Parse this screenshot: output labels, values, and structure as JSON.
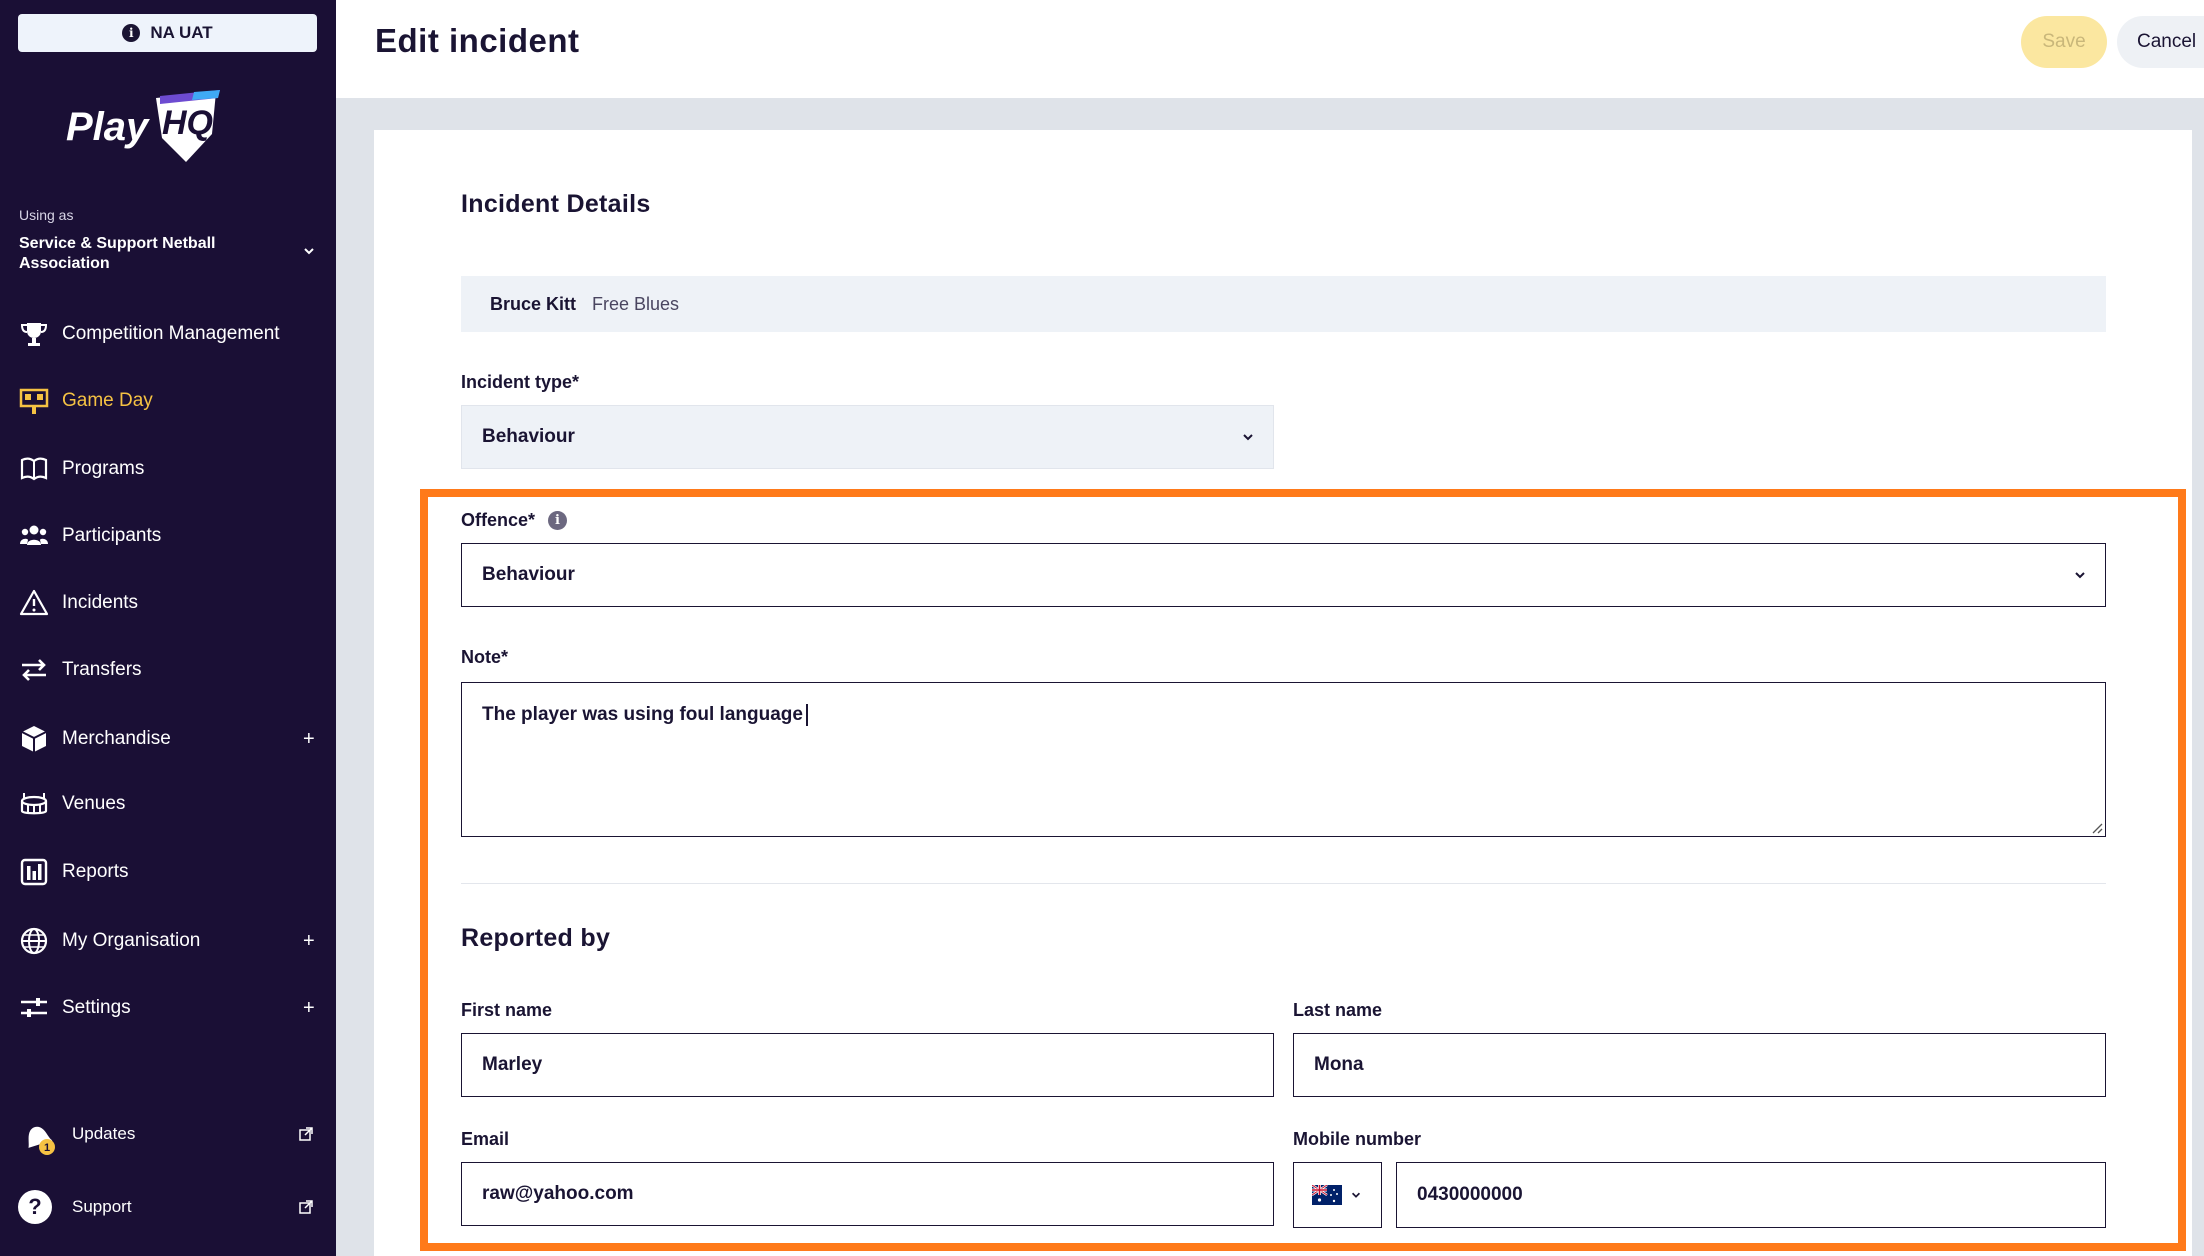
{
  "env": {
    "label": "NA UAT",
    "info_icon": "info-icon"
  },
  "brand": {
    "logo_text": "Play",
    "logo_mark": "HQ"
  },
  "org": {
    "using_as": "Using as",
    "name": "Service & Support Netball Association"
  },
  "nav": {
    "items": [
      {
        "label": "Competition Management",
        "icon": "trophy-icon",
        "expandable": false
      },
      {
        "label": "Game Day",
        "icon": "scoreboard-icon",
        "expandable": false,
        "active": true
      },
      {
        "label": "Programs",
        "icon": "book-icon",
        "expandable": false
      },
      {
        "label": "Participants",
        "icon": "people-icon",
        "expandable": false
      },
      {
        "label": "Incidents",
        "icon": "warning-icon",
        "expandable": false
      },
      {
        "label": "Transfers",
        "icon": "transfer-icon",
        "expandable": false
      },
      {
        "label": "Merchandise",
        "icon": "box-icon",
        "expandable": true
      },
      {
        "label": "Venues",
        "icon": "stadium-icon",
        "expandable": false
      },
      {
        "label": "Reports",
        "icon": "chart-icon",
        "expandable": false
      },
      {
        "label": "My Organisation",
        "icon": "globe-icon",
        "expandable": true
      },
      {
        "label": "Settings",
        "icon": "sliders-icon",
        "expandable": true
      }
    ],
    "plus": "+",
    "updates": {
      "label": "Updates",
      "badge": "1"
    },
    "support": {
      "label": "Support",
      "icon_glyph": "?"
    }
  },
  "header": {
    "title": "Edit incident",
    "save_label": "Save",
    "cancel_label": "Cancel"
  },
  "form": {
    "details_title": "Incident Details",
    "subject": {
      "name": "Bruce Kitt",
      "team": "Free Blues"
    },
    "incident_type": {
      "label": "Incident type*",
      "value": "Behaviour"
    },
    "offence": {
      "label": "Offence*",
      "value": "Behaviour",
      "info_glyph": "i"
    },
    "note": {
      "label": "Note*",
      "value": "The player was using foul language"
    },
    "reported_by": {
      "title": "Reported by",
      "first_name": {
        "label": "First name",
        "value": "Marley"
      },
      "last_name": {
        "label": "Last name",
        "value": "Mona"
      },
      "email": {
        "label": "Email",
        "value": "raw@yahoo.com"
      },
      "mobile": {
        "label": "Mobile number",
        "country": "AU",
        "value": "0430000000"
      }
    }
  },
  "colors": {
    "sidebar": "#1a0f35",
    "accent": "#f5c243",
    "highlight": "#ff7a1a",
    "canvas": "#dfe3e9"
  }
}
